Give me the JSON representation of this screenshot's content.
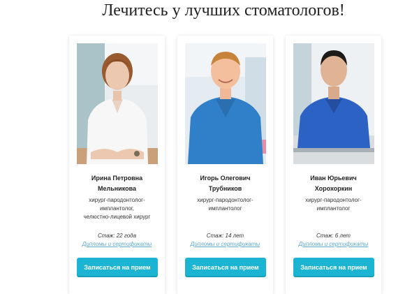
{
  "section": {
    "title": "Лечитесь у лучших стоматологов!"
  },
  "doctors": [
    {
      "name_line1": "Ирина Петровна",
      "name_line2": "Мельникова",
      "role_lines": [
        "хирург-пародонтолог-",
        "имплантолог,",
        "челюстно-лицевой хирург"
      ],
      "experience": "Стаж: 22 года",
      "diplomas_link": "Дипломы и сертификаты",
      "book_button": "Записаться на прием"
    },
    {
      "name_line1": "Игорь Олегович",
      "name_line2": "Трубников",
      "role_lines": [
        "хирург-пародонтолог-",
        "имплантолог"
      ],
      "experience": "Стаж: 14 лет",
      "diplomas_link": "Дипломы и сертификаты",
      "book_button": "Записаться на прием"
    },
    {
      "name_line1": "Иван Юрьевич",
      "name_line2": "Хорохоркин",
      "role_lines": [
        "хирург-пародонтолог-",
        "имплантолог"
      ],
      "experience": "Стаж: 6 лет",
      "diplomas_link": "Дипломы и сертификаты",
      "book_button": "Записаться на прием"
    }
  ],
  "colors": {
    "button": "#1bb5d3",
    "link": "#5aa7c9",
    "scrub_blue": "#2f7fc9"
  }
}
